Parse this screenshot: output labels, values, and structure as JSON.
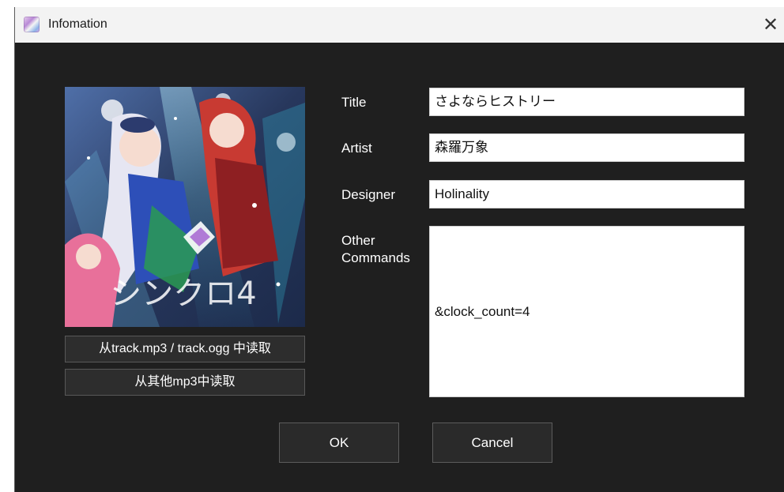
{
  "window": {
    "title": "Infomation",
    "close_glyph": "✕",
    "app_icon": "app-icon"
  },
  "cover": {
    "subject": "album cover art",
    "logo_text": "シンクロ4",
    "colors": {
      "background": "#27375c",
      "accent_cyan": "#39d0e8",
      "accent_pink": "#e8709a",
      "hair_silver": "#e6e6f2",
      "hair_red": "#c83a32",
      "dress_blue": "#2d4fb8"
    }
  },
  "buttons": {
    "read_track": "从track.mp3 / track.ogg 中读取",
    "read_other": "从其他mp3中读取",
    "ok": "OK",
    "cancel": "Cancel"
  },
  "fields": {
    "title": {
      "label": "Title",
      "value": "さよならヒストリー"
    },
    "artist": {
      "label": "Artist",
      "value": "森羅万象"
    },
    "designer": {
      "label": "Designer",
      "value": "Holinality"
    },
    "other_commands": {
      "label_line1": "Other",
      "label_line2": "Commands",
      "value": "&clock_count=4"
    }
  },
  "theme": {
    "window_bg": "#1f1f1f",
    "titlebar_bg": "#f3f3f3",
    "button_bg": "#2d2d2d",
    "button_border": "#585858"
  }
}
